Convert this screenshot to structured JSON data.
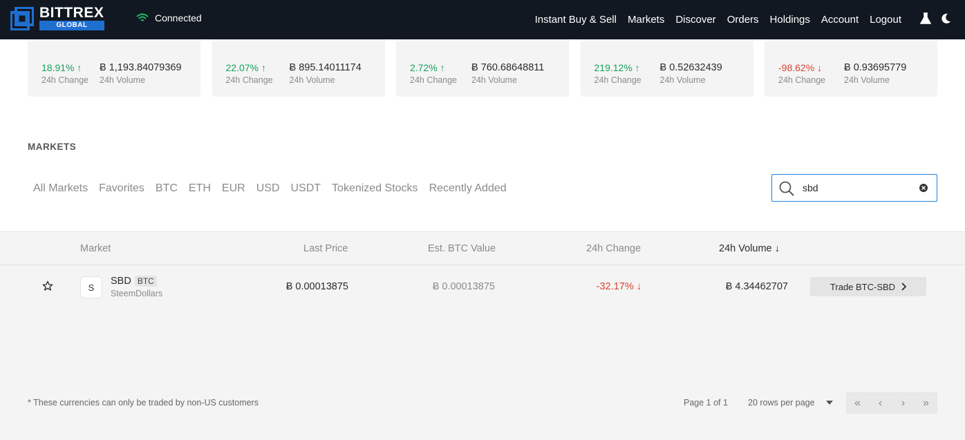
{
  "header": {
    "logo_word": "BITTREX",
    "logo_sub": "GLOBAL",
    "status": "Connected",
    "nav": [
      "Instant Buy & Sell",
      "Markets",
      "Discover",
      "Orders",
      "Holdings",
      "Account",
      "Logout"
    ],
    "icons": [
      "flask-icon",
      "moon-icon"
    ]
  },
  "cards": [
    {
      "change": "18.91%",
      "direction": "up",
      "volume": "Ƀ 1,193.84079369",
      "change_label": "24h Change",
      "volume_label": "24h Volume"
    },
    {
      "change": "22.07%",
      "direction": "up",
      "volume": "Ƀ 895.14011174",
      "change_label": "24h Change",
      "volume_label": "24h Volume"
    },
    {
      "change": "2.72%",
      "direction": "up",
      "volume": "Ƀ 760.68648811",
      "change_label": "24h Change",
      "volume_label": "24h Volume"
    },
    {
      "change": "219.12%",
      "direction": "up",
      "volume": "Ƀ 0.52632439",
      "change_label": "24h Change",
      "volume_label": "24h Volume"
    },
    {
      "change": "-98.62%",
      "direction": "down",
      "volume": "Ƀ 0.93695779",
      "change_label": "24h Change",
      "volume_label": "24h Volume"
    }
  ],
  "markets": {
    "title": "MARKETS",
    "tabs": [
      "All Markets",
      "Favorites",
      "BTC",
      "ETH",
      "EUR",
      "USD",
      "USDT",
      "Tokenized Stocks",
      "Recently Added"
    ],
    "search_value": "sbd"
  },
  "table": {
    "headers": {
      "market": "Market",
      "last_price": "Last Price",
      "btc_value": "Est. BTC Value",
      "change": "24h Change",
      "volume": "24h Volume"
    },
    "rows": [
      {
        "icon_letter": "S",
        "symbol": "SBD",
        "base": "BTC",
        "name": "SteemDollars",
        "last_price": "Ƀ 0.00013875",
        "btc_value": "Ƀ 0.00013875",
        "change": "-32.17%",
        "volume": "Ƀ 4.34462707",
        "trade_label": "Trade BTC-SBD"
      }
    ]
  },
  "footer": {
    "note": "* These currencies can only be traded by non-US customers",
    "page": "Page 1 of 1",
    "rows_per_page": "20 rows per page"
  },
  "colors": {
    "positive": "#15a15a",
    "negative": "#d9432f",
    "accent": "#1f7fd6",
    "header_bg": "#121821"
  }
}
